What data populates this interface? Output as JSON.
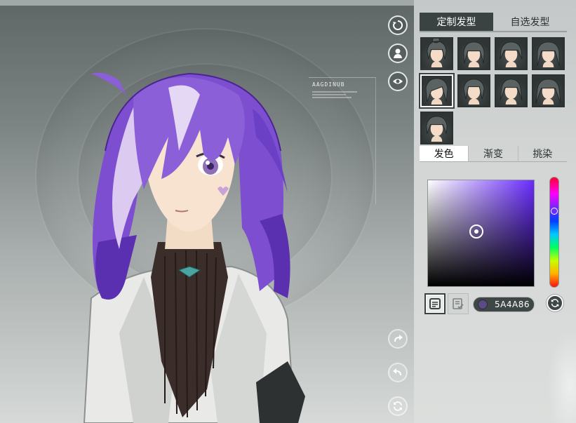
{
  "hud": {
    "text": "AAGDINUB"
  },
  "panel": {
    "tabs": [
      {
        "label": "定制发型",
        "active": true
      },
      {
        "label": "自选发型",
        "active": false
      }
    ],
    "hairstyle_count": 9,
    "selected_hairstyle": 5,
    "color_tabs": [
      {
        "label": "发色",
        "active": true
      },
      {
        "label": "渐变",
        "active": false
      },
      {
        "label": "挑染",
        "active": false
      }
    ],
    "hex_value": "5A4A86"
  },
  "picker": {
    "hue_color": "#6a2cff",
    "saturation": 0.45,
    "brightness": 0.52,
    "hue_position": 0.31
  },
  "colors": {
    "selected_hair": "#5A4A86",
    "hair_main": "#8a5fd8",
    "hair_light": "#d9c8ee",
    "hair_dark": "#5a2fb0",
    "panel_dark": "#3b4242"
  }
}
